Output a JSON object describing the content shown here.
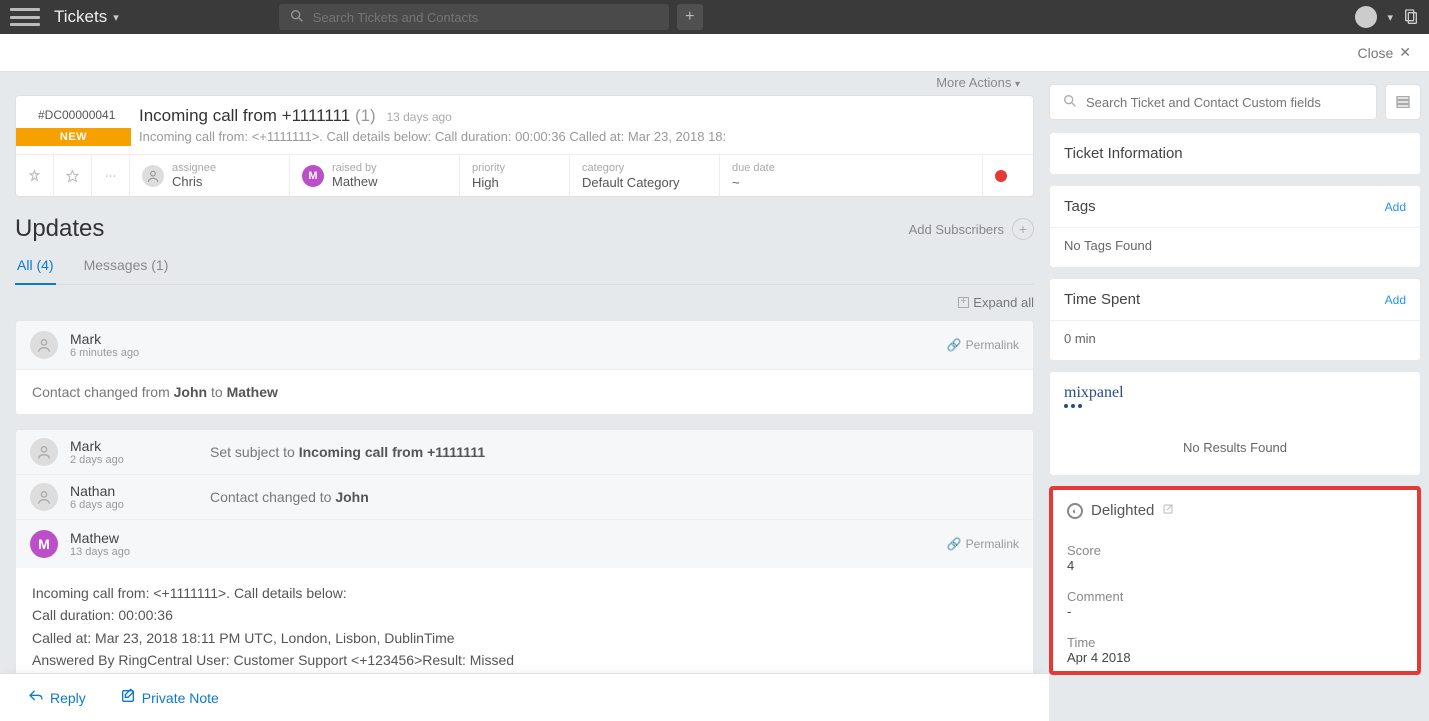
{
  "topbar": {
    "module": "Tickets",
    "search_placeholder": "Search Tickets and Contacts"
  },
  "subbar": {
    "close": "Close"
  },
  "more_actions": "More Actions",
  "ticket": {
    "number": "#DC00000041",
    "badge": "NEW",
    "title": "Incoming call from +1111111",
    "count": "(1)",
    "time": "13 days ago",
    "desc": "Incoming call from: <+1111111>. Call details below: Call duration: 00:00:36 Called at: Mar 23, 2018 18:",
    "assignee_label": "assignee",
    "assignee_value": "Chris",
    "raisedby_label": "raised by",
    "raisedby_value": "Mathew",
    "priority_label": "priority",
    "priority_value": "High",
    "category_label": "category",
    "category_value": "Default Category",
    "duedate_label": "due date",
    "duedate_value": "~"
  },
  "updates": {
    "heading": "Updates",
    "add_subscribers": "Add Subscribers",
    "tab_all": "All (4)",
    "tab_messages": "Messages (1)",
    "expand_all": "Expand all"
  },
  "u1": {
    "name": "Mark",
    "time": "6 minutes ago",
    "permalink": "Permalink",
    "body_pre": "Contact changed from ",
    "body_b1": "John",
    "body_mid": " to ",
    "body_b2": "Mathew"
  },
  "u2a": {
    "name": "Mark",
    "time": "2 days ago",
    "msg_pre": "Set subject to ",
    "msg_b": "Incoming call from +1111111"
  },
  "u2b": {
    "name": "Nathan",
    "time": "6 days ago",
    "msg_pre": "Contact changed to ",
    "msg_b": "John"
  },
  "u3": {
    "name": "Mathew",
    "time": "13 days ago",
    "permalink": "Permalink",
    "l1": "Incoming call from: <+1111111>. Call details below:",
    "l2": "Call duration: 00:00:36",
    "l3": "Called at: Mar 23, 2018 18:11 PM UTC, London, Lisbon, DublinTime",
    "l4": "Answered By RingCentral User: Customer Support <+123456>Result: Missed"
  },
  "replybar": {
    "reply": "Reply",
    "private": "Private Note"
  },
  "side_search_placeholder": "Search Ticket and Contact Custom fields",
  "panels": {
    "ticketinfo": "Ticket Information",
    "tags": "Tags",
    "tags_body": "No Tags Found",
    "add": "Add",
    "timespent": "Time Spent",
    "timespent_val": "0 min",
    "mixpanel": "mixpanel",
    "noresults": "No Results Found"
  },
  "delighted": {
    "title": "Delighted",
    "score_l": "Score",
    "score_v": "4",
    "comment_l": "Comment",
    "comment_v": "-",
    "time_l": "Time",
    "time_v": "Apr 4 2018"
  }
}
